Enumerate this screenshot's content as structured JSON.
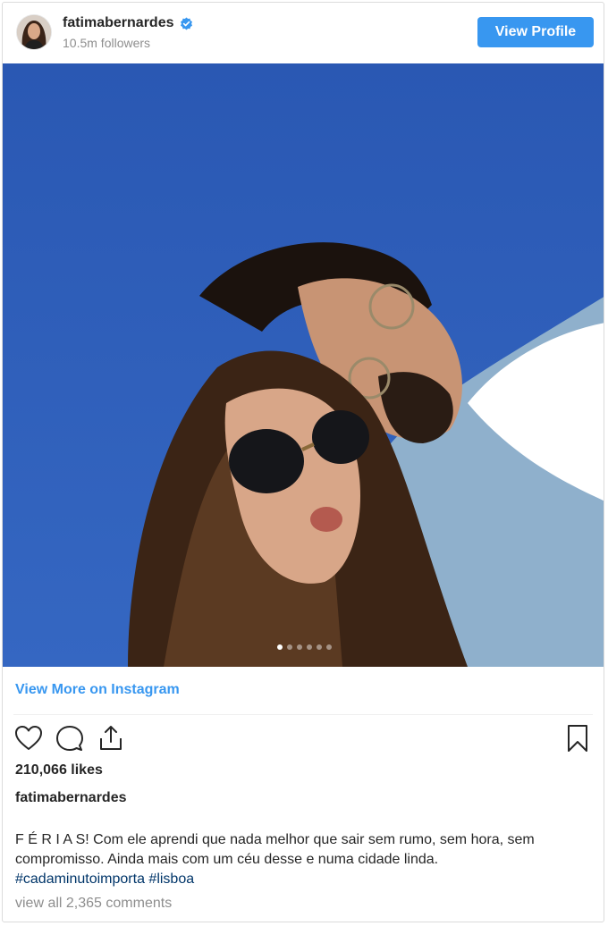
{
  "header": {
    "username": "fatimabernardes",
    "followers": "10.5m followers",
    "view_profile_label": "View Profile"
  },
  "post": {
    "carousel_total": 6,
    "carousel_active": 1,
    "view_more_label": "View More on Instagram",
    "likes": "210,066 likes",
    "caption_user": "fatimabernardes",
    "caption_text": "F É R I A S! Com ele aprendi que nada melhor que sair sem rumo, sem hora, sem compromisso. Ainda mais com um céu desse e numa cidade linda.",
    "hashtag_1": "#cadaminutoimporta",
    "hashtag_2": "#lisboa",
    "comments_label": "view all 2,365 comments"
  },
  "icons": {
    "verified": "verified-badge-icon",
    "like": "heart-icon",
    "comment": "comment-bubble-icon",
    "share": "share-upload-icon",
    "save": "bookmark-icon"
  },
  "colors": {
    "accent": "#3897f0",
    "sky": "#2d5fb8",
    "hashtag": "#003569",
    "muted": "#8e8e8e"
  }
}
